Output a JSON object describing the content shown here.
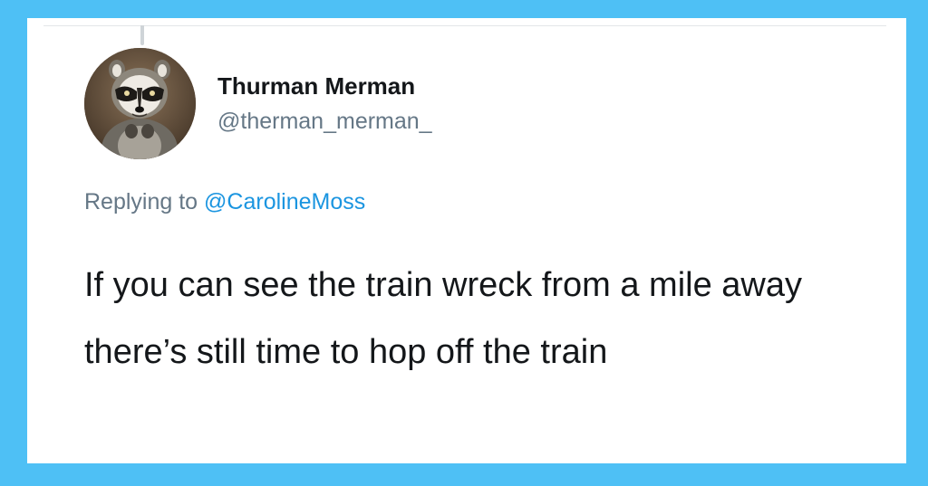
{
  "tweet": {
    "author": {
      "display_name": "Thurman Merman",
      "handle": "@therman_merman_",
      "avatar_icon": "raccoon-avatar"
    },
    "reply": {
      "prefix": "Replying to",
      "mention": "@CarolineMoss"
    },
    "text": "If you can see the train wreck from a mile away there’s still time to hop off the train"
  },
  "colors": {
    "frame_background": "#4ec0f5",
    "card_background": "#ffffff",
    "name_text": "#14171a",
    "secondary_text": "#657786",
    "mention_link": "#1b95e0"
  }
}
